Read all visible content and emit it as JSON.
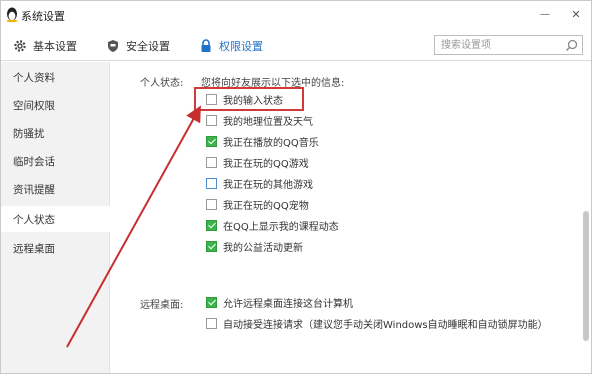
{
  "window": {
    "title": "系统设置",
    "minimize_glyph": "—",
    "close_glyph": "✕"
  },
  "tabs": [
    {
      "label": "基本设置",
      "icon": "gear-icon"
    },
    {
      "label": "安全设置",
      "icon": "shield-icon"
    },
    {
      "label": "权限设置",
      "icon": "lock-icon",
      "active": true
    }
  ],
  "search": {
    "placeholder": "搜索设置项",
    "value": ""
  },
  "sidebar": {
    "items": [
      {
        "label": "个人资料"
      },
      {
        "label": "空间权限"
      },
      {
        "label": "防骚扰"
      },
      {
        "label": "临时会话"
      },
      {
        "label": "资讯提醒"
      },
      {
        "label": "个人状态",
        "active": true
      },
      {
        "label": "远程桌面"
      }
    ]
  },
  "status_section": {
    "label": "个人状态:",
    "hint": "您将向好友展示以下选中的信息:",
    "options": [
      {
        "label": "我的输入状态",
        "checked": false
      },
      {
        "label": "我的地理位置及天气",
        "checked": false
      },
      {
        "label": "我正在播放的QQ音乐",
        "checked": true
      },
      {
        "label": "我正在玩的QQ游戏",
        "checked": false
      },
      {
        "label": "我正在玩的其他游戏",
        "checked": false
      },
      {
        "label": "我正在玩的QQ宠物",
        "checked": false
      },
      {
        "label": "在QQ上显示我的课程动态",
        "checked": true
      },
      {
        "label": "我的公益活动更新",
        "checked": true
      }
    ]
  },
  "remote_section": {
    "label": "远程桌面:",
    "options": [
      {
        "label": "允许远程桌面连接这台计算机",
        "checked": true
      },
      {
        "label": "自动接受连接请求（建议您手动关闭Windows自动睡眠和自动锁屏功能）",
        "checked": false
      }
    ]
  },
  "colors": {
    "accent": "#1e72c8",
    "check_green": "#3bb54a",
    "annotation_red": "#d23a3a",
    "sidebar_bg": "#f2f2f2"
  }
}
